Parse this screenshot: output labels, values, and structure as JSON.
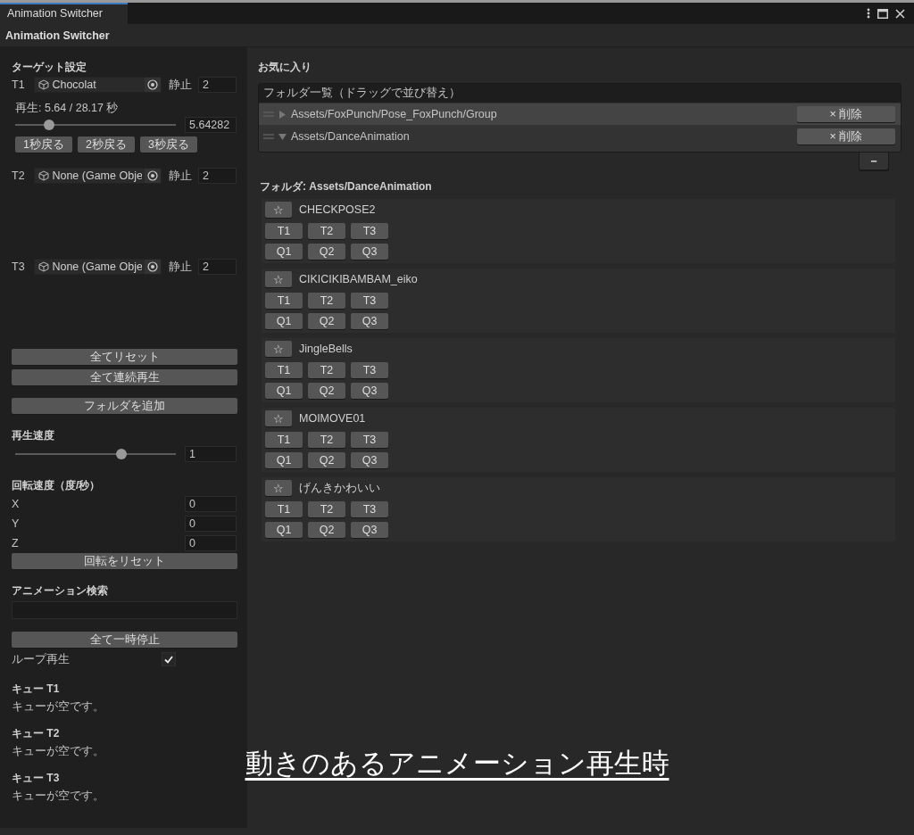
{
  "window": {
    "tab": "Animation Switcher",
    "title": "Animation Switcher"
  },
  "left": {
    "target_heading": "ターゲット設定",
    "targets": [
      {
        "label": "T1",
        "object": "Chocolat",
        "stop_label": "静止",
        "stop_value": "2",
        "playback": {
          "text": "再生: 5.64 / 28.17 秒",
          "level": 0.21,
          "value": "5.64282",
          "buttons": [
            "1秒戻る",
            "2秒戻る",
            "3秒戻る"
          ]
        }
      },
      {
        "label": "T2",
        "object": "None (Game Obje",
        "stop_label": "静止",
        "stop_value": "2"
      },
      {
        "label": "T3",
        "object": "None (Game Obje",
        "stop_label": "静止",
        "stop_value": "2"
      }
    ],
    "reset_all": "全てリセット",
    "play_all": "全て連続再生",
    "add_folder": "フォルダを追加",
    "speed": {
      "heading": "再生速度",
      "level": 0.66,
      "value": "1"
    },
    "rotation": {
      "heading": "回転速度（度/秒）",
      "axes": [
        {
          "label": "X",
          "value": "0"
        },
        {
          "label": "Y",
          "value": "0"
        },
        {
          "label": "Z",
          "value": "0"
        }
      ],
      "reset": "回転をリセット"
    },
    "search": {
      "heading": "アニメーション検索"
    },
    "pause_all": "全て一時停止",
    "loop": {
      "label": "ループ再生",
      "checked": true
    },
    "queues": [
      {
        "heading": "キュー T1",
        "text": "キューが空です。"
      },
      {
        "heading": "キュー T2",
        "text": "キューが空です。"
      },
      {
        "heading": "キュー T3",
        "text": "キューが空です。"
      }
    ]
  },
  "right": {
    "favorites_heading": "お気に入り",
    "folder_list": {
      "header": "フォルダ一覧（ドラッグで並び替え）",
      "items": [
        {
          "path": "Assets/FoxPunch/Pose_FoxPunch/Group",
          "expanded": false,
          "selected": true,
          "delete": "× 削除"
        },
        {
          "path": "Assets/DanceAnimation",
          "expanded": true,
          "selected": false,
          "delete": "× 削除"
        }
      ],
      "remove_button": "−"
    },
    "folder_heading": "フォルダ: Assets/DanceAnimation",
    "animations": [
      {
        "star": "☆",
        "name": "CHECKPOSE2",
        "targets": [
          "T1",
          "T2",
          "T3"
        ],
        "queues": [
          "Q1",
          "Q2",
          "Q3"
        ]
      },
      {
        "star": "☆",
        "name": "CIKICIKIBAMBAM_eiko",
        "targets": [
          "T1",
          "T2",
          "T3"
        ],
        "queues": [
          "Q1",
          "Q2",
          "Q3"
        ]
      },
      {
        "star": "☆",
        "name": "JingleBells",
        "targets": [
          "T1",
          "T2",
          "T3"
        ],
        "queues": [
          "Q1",
          "Q2",
          "Q3"
        ]
      },
      {
        "star": "☆",
        "name": "MOIMOVE01",
        "targets": [
          "T1",
          "T2",
          "T3"
        ],
        "queues": [
          "Q1",
          "Q2",
          "Q3"
        ]
      },
      {
        "star": "☆",
        "name": "げんきかわいい",
        "targets": [
          "T1",
          "T2",
          "T3"
        ],
        "queues": [
          "Q1",
          "Q2",
          "Q3"
        ]
      }
    ]
  },
  "caption": "動きのあるアニメーション再生時"
}
